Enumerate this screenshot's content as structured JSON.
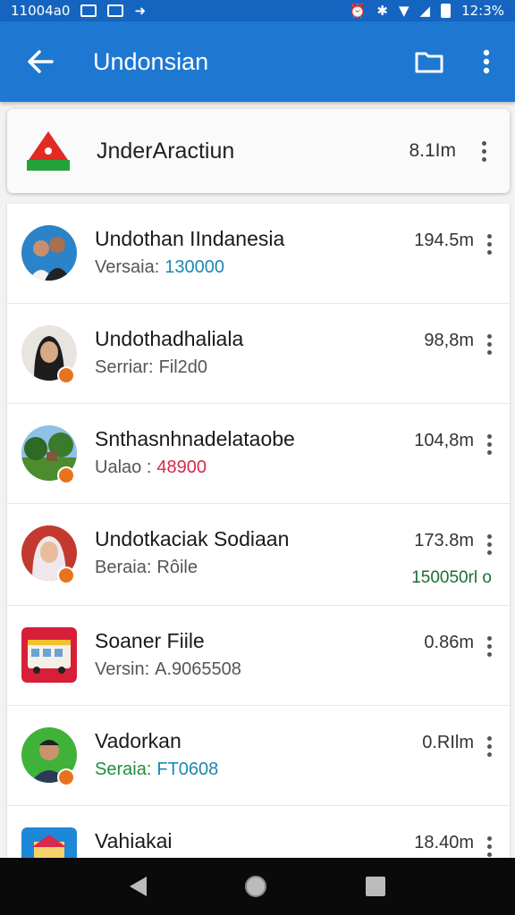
{
  "status": {
    "left_text": "11004a0",
    "time": "12:3%"
  },
  "appbar": {
    "title": "Undonsian"
  },
  "header_card": {
    "title": "JnderAractiun",
    "size": "8.1Im"
  },
  "items": [
    {
      "title": "Undothan IIndanesia",
      "label": "Versaia:",
      "value": "130000",
      "value_color": "#1e88b0",
      "size": "194.5m",
      "extra": ""
    },
    {
      "title": "Undothadhaliala",
      "label": "Serriar:",
      "value": "Fil2d0",
      "value_color": "#555555",
      "size": "98,8m",
      "extra": ""
    },
    {
      "title": "Snthasnhnadelataobe",
      "label": "Ualao :",
      "value": "48900",
      "value_color": "#d8294a",
      "size": "104,8m",
      "extra": ""
    },
    {
      "title": "Undotkaciak Sodiaan",
      "label": "Beraia:",
      "value": "Rôile",
      "value_color": "#555555",
      "size": "173.8m",
      "extra": "150050rl o"
    },
    {
      "title": "Soaner Fiile",
      "label": "Versin:",
      "value": "A.9065508",
      "value_color": "#555555",
      "size": "0.86m",
      "extra": ""
    },
    {
      "title": "Vadorkan",
      "label": "Seraia:",
      "value": "FT0608",
      "value_color": "#1e88b0",
      "size": "0.RIlm",
      "extra": ""
    },
    {
      "title": "Vahiakai",
      "label": "",
      "value": "",
      "value_color": "#555555",
      "size": "18.40m",
      "extra": ""
    }
  ],
  "colors": {
    "appbar": "#1e78d2",
    "statusbar": "#1565c0",
    "accent_green": "#1b6e2e"
  }
}
